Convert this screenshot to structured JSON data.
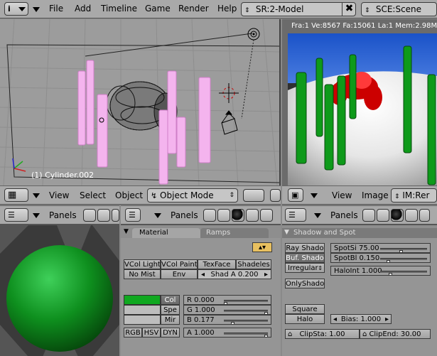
{
  "top_menu": {
    "items": [
      "File",
      "Add",
      "Timeline",
      "Game",
      "Render",
      "Help"
    ],
    "screen_field": "SR:2-Model",
    "scene_field": "SCE:Scene",
    "info_icon": "i"
  },
  "viewport3d": {
    "object_label": "(1) Cylinder.002",
    "header": {
      "view": "View",
      "select": "Select",
      "object": "Object",
      "mode": "Object Mode"
    }
  },
  "render": {
    "info": "Fra:1  Ve:8567 Fa:15061 La:1 Mem:2.98M (",
    "header": {
      "view": "View",
      "image": "Image",
      "image_field": "IM:Rer"
    }
  },
  "panels_headers": {
    "left": "Panels",
    "middle": "Panels",
    "right": "Panels"
  },
  "material": {
    "tabs": [
      "Material",
      "Ramps"
    ],
    "row1": [
      "VCol Light",
      "VCol Paint",
      "TexFace",
      "Shadeles"
    ],
    "row2": [
      "No Mist",
      "Env",
      "Shad A 0.200"
    ],
    "color_buttons": [
      "Col",
      "Spe",
      "Mir"
    ],
    "color_swatches": [
      "#10a820",
      "#bdbdbd",
      "#bdbdbd"
    ],
    "rgb": [
      "R 0.000",
      "G 1.000",
      "B 0.177"
    ],
    "rgb_fill": [
      0.0,
      1.0,
      0.177
    ],
    "alpha": "A 1.000",
    "alpha_fill": 1.0,
    "modes": [
      "RGB",
      "HSV",
      "DYN"
    ]
  },
  "shadow": {
    "title": "Shadow and Spot",
    "ray_shado": "Ray Shado",
    "buf_shado": "Buf. Shado",
    "irregular": "Irregular",
    "spotsi": "SpotSi 75.00",
    "spotbl": "SpotBl 0.150",
    "haloint": "HaloInt 1.000",
    "spotsi_fill": 0.45,
    "spotbl_fill": 0.15,
    "haloint_fill": 0.2,
    "onlyshado": "OnlyShado",
    "square": "Square",
    "halo": "Halo",
    "bias": "Bias: 1.000",
    "clipsta": "ClipSta: 1.00",
    "clipend": "ClipEnd: 30.00"
  },
  "colors": {
    "material_green": "#0e8f1e",
    "render_green": "#118c1a",
    "render_red": "#e00000",
    "render_blue": "#2a5fd0",
    "wire_pink": "#f4b4ee"
  }
}
